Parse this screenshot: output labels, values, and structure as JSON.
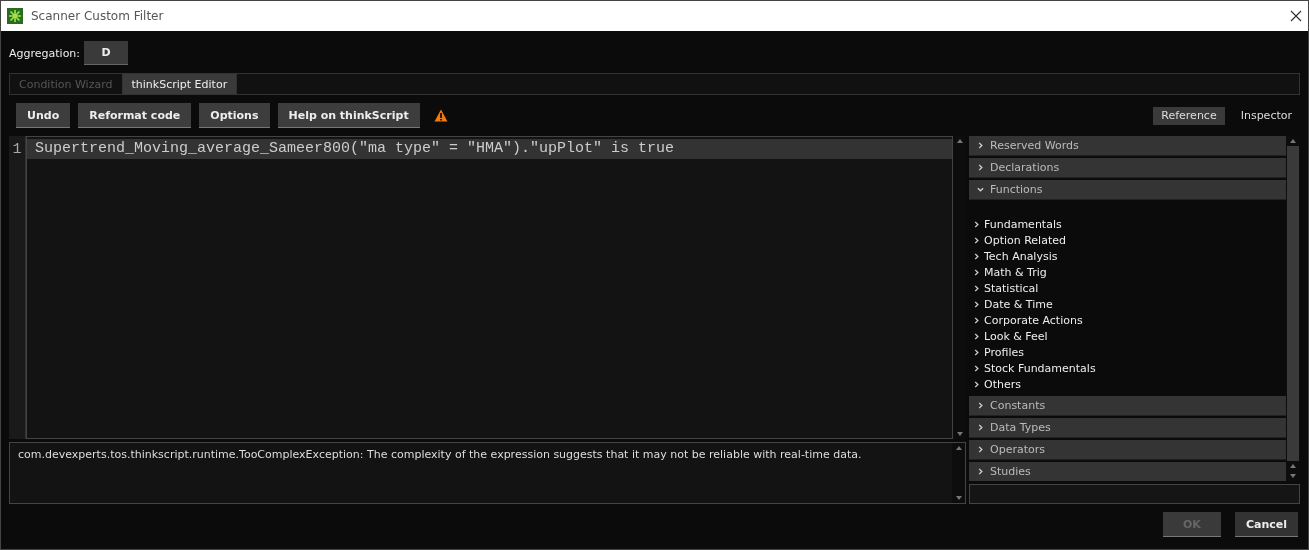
{
  "window": {
    "title": "Scanner Custom Filter"
  },
  "aggregation": {
    "label": "Aggregation:",
    "value": "D"
  },
  "tabs": [
    {
      "label": "Condition Wizard",
      "selected": false
    },
    {
      "label": "thinkScript Editor",
      "selected": true
    }
  ],
  "toolbar": {
    "buttons": [
      "Undo",
      "Reformat code",
      "Options",
      "Help on thinkScript"
    ],
    "warning": true
  },
  "panel_tabs": [
    {
      "label": "Reference",
      "selected": true
    },
    {
      "label": "Inspector",
      "selected": false
    }
  ],
  "editor": {
    "lines": [
      {
        "number": "1",
        "code": "Supertrend_Moving_average_Sameer800(\"ma type\" = \"HMA\").\"upPlot\" is true"
      }
    ]
  },
  "message": "com.devexperts.tos.thinkscript.runtime.TooComplexException: The complexity of the expression suggests that it may not be reliable with real-time data.",
  "reference": {
    "sections": [
      {
        "label": "Reserved Words",
        "expanded": false
      },
      {
        "label": "Declarations",
        "expanded": false
      },
      {
        "label": "Functions",
        "expanded": true,
        "children": [
          "Fundamentals",
          "Option Related",
          "Tech Analysis",
          "Math & Trig",
          "Statistical",
          "Date & Time",
          "Corporate Actions",
          "Look & Feel",
          "Profiles",
          "Stock Fundamentals",
          "Others"
        ]
      },
      {
        "label": "Constants",
        "expanded": false
      },
      {
        "label": "Data Types",
        "expanded": false
      },
      {
        "label": "Operators",
        "expanded": false
      },
      {
        "label": "Studies",
        "expanded": false
      }
    ]
  },
  "footer": {
    "buttons": [
      {
        "label": "OK",
        "disabled": true
      },
      {
        "label": "Cancel",
        "disabled": false
      }
    ]
  }
}
